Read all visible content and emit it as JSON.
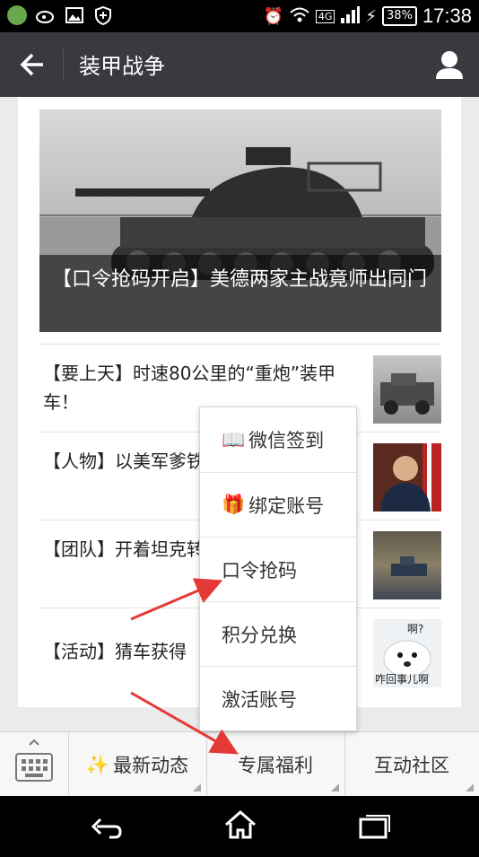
{
  "status_bar": {
    "battery": "38%",
    "network": "4G",
    "time": "17:38"
  },
  "header": {
    "title": "装甲战争"
  },
  "featured": {
    "caption": "【口令抢码开启】美德两家主战竟师出同门"
  },
  "articles": [
    {
      "title": "【要上天】时速80公里的“重炮”装甲车！"
    },
    {
      "title": "【人物】以美军爹铁雄狮"
    },
    {
      "title": "【团队】开着坦克转《装甲战争》副"
    },
    {
      "title": "【活动】猜车获得"
    }
  ],
  "thumb_text": {
    "seal_top": "啊?",
    "seal_bottom": "咋回事儿啊"
  },
  "bottom_menu": [
    {
      "label": "最新动态",
      "icon": "sparkles-icon"
    },
    {
      "label": "专属福利"
    },
    {
      "label": "互动社区"
    }
  ],
  "popup_menu": [
    {
      "label": "微信签到",
      "icon": "book-icon"
    },
    {
      "label": "绑定账号",
      "icon": "gift-icon"
    },
    {
      "label": "口令抢码"
    },
    {
      "label": "积分兑换"
    },
    {
      "label": "激活账号"
    }
  ],
  "colors": {
    "header_bg": "#393a3f",
    "annotation_red": "#e53935"
  }
}
